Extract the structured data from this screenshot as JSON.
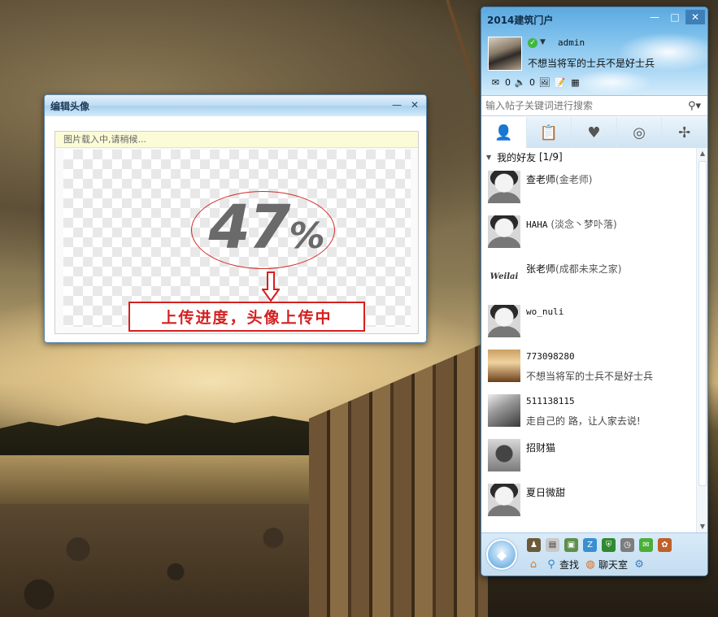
{
  "edit_window": {
    "title": "编辑头像",
    "minimize_glyph": "—",
    "close_glyph": "✕",
    "loading_text": "图片载入中,请稍候...",
    "progress_number": "47",
    "progress_percent_sign": "%",
    "progress_value_percent": 47,
    "annotation_caption": "上传进度，头像上传中",
    "annotation_color": "#d52020"
  },
  "qq_panel": {
    "title": "2014建筑门户",
    "minimize_glyph": "—",
    "maximize_glyph": "□",
    "close_glyph": "✕",
    "username": "admin",
    "signature": "不想当将军的士兵不是好士兵",
    "mail_count": "0",
    "notice_count": "0",
    "search_placeholder": "输入帖子关键词进行搜索",
    "tabs": [
      "contacts-icon",
      "notes-icon",
      "heart-icon",
      "compass-icon",
      "signpost-icon"
    ],
    "group": {
      "label": "我的好友",
      "count": "[1/9]"
    },
    "friends": [
      {
        "name": "查老师",
        "sub": "(金老师)",
        "signature": "",
        "avatar": "default"
      },
      {
        "name": "HAHA",
        "sub": "(淡念丶梦卟落)",
        "signature": "",
        "avatar": "default"
      },
      {
        "name": "张老师",
        "sub": "(成都未来之家)",
        "signature": "",
        "avatar": "logo",
        "avatar_text": "Weilai"
      },
      {
        "name": "wo_nuli",
        "sub": "",
        "signature": "",
        "avatar": "default"
      },
      {
        "name": "773098280",
        "sub": "",
        "signature": "不想当将军的士兵不是好士兵",
        "avatar": "photo1"
      },
      {
        "name": "511138115",
        "sub": "",
        "signature": "走自己的 路，让人家去说!",
        "avatar": "photo2"
      },
      {
        "name": "招财猫",
        "sub": "",
        "signature": "",
        "avatar": "photo3"
      },
      {
        "name": "夏日微甜",
        "sub": "",
        "signature": "",
        "avatar": "default"
      }
    ],
    "bottom": {
      "find_label": "查找",
      "chatroom_label": "聊天室"
    },
    "accent_color": "#5ba9e0"
  }
}
